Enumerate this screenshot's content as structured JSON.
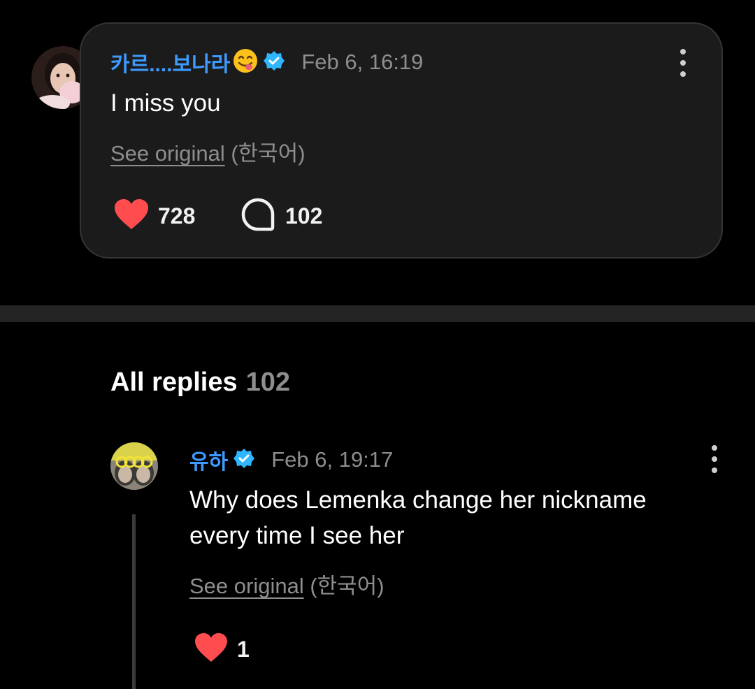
{
  "post": {
    "username": "카르....보나라",
    "timestamp": "Feb 6, 16:19",
    "text": "I miss you",
    "see_original": "See original",
    "language": "(한국어)",
    "likes": "728",
    "replies": "102"
  },
  "replies_section": {
    "title": "All replies",
    "count": "102"
  },
  "reply": {
    "username": "유하",
    "timestamp": "Feb 6, 19:17",
    "text_line1": "Why does Lemenka change her nickname",
    "text_line2": "every time I see her",
    "see_original": "See original",
    "language": "(한국어)",
    "likes": "1"
  },
  "icons": {
    "verified": "verified-badge-icon",
    "like": "heart-icon",
    "reply": "comment-bubble-icon",
    "more": "more-vertical-icon"
  },
  "colors": {
    "background": "#000000",
    "card": "#1b1b1b",
    "username": "#3d9bff",
    "verified": "#2fb6ff",
    "heart": "#ff4d4f",
    "muted": "#8e8e8e"
  }
}
